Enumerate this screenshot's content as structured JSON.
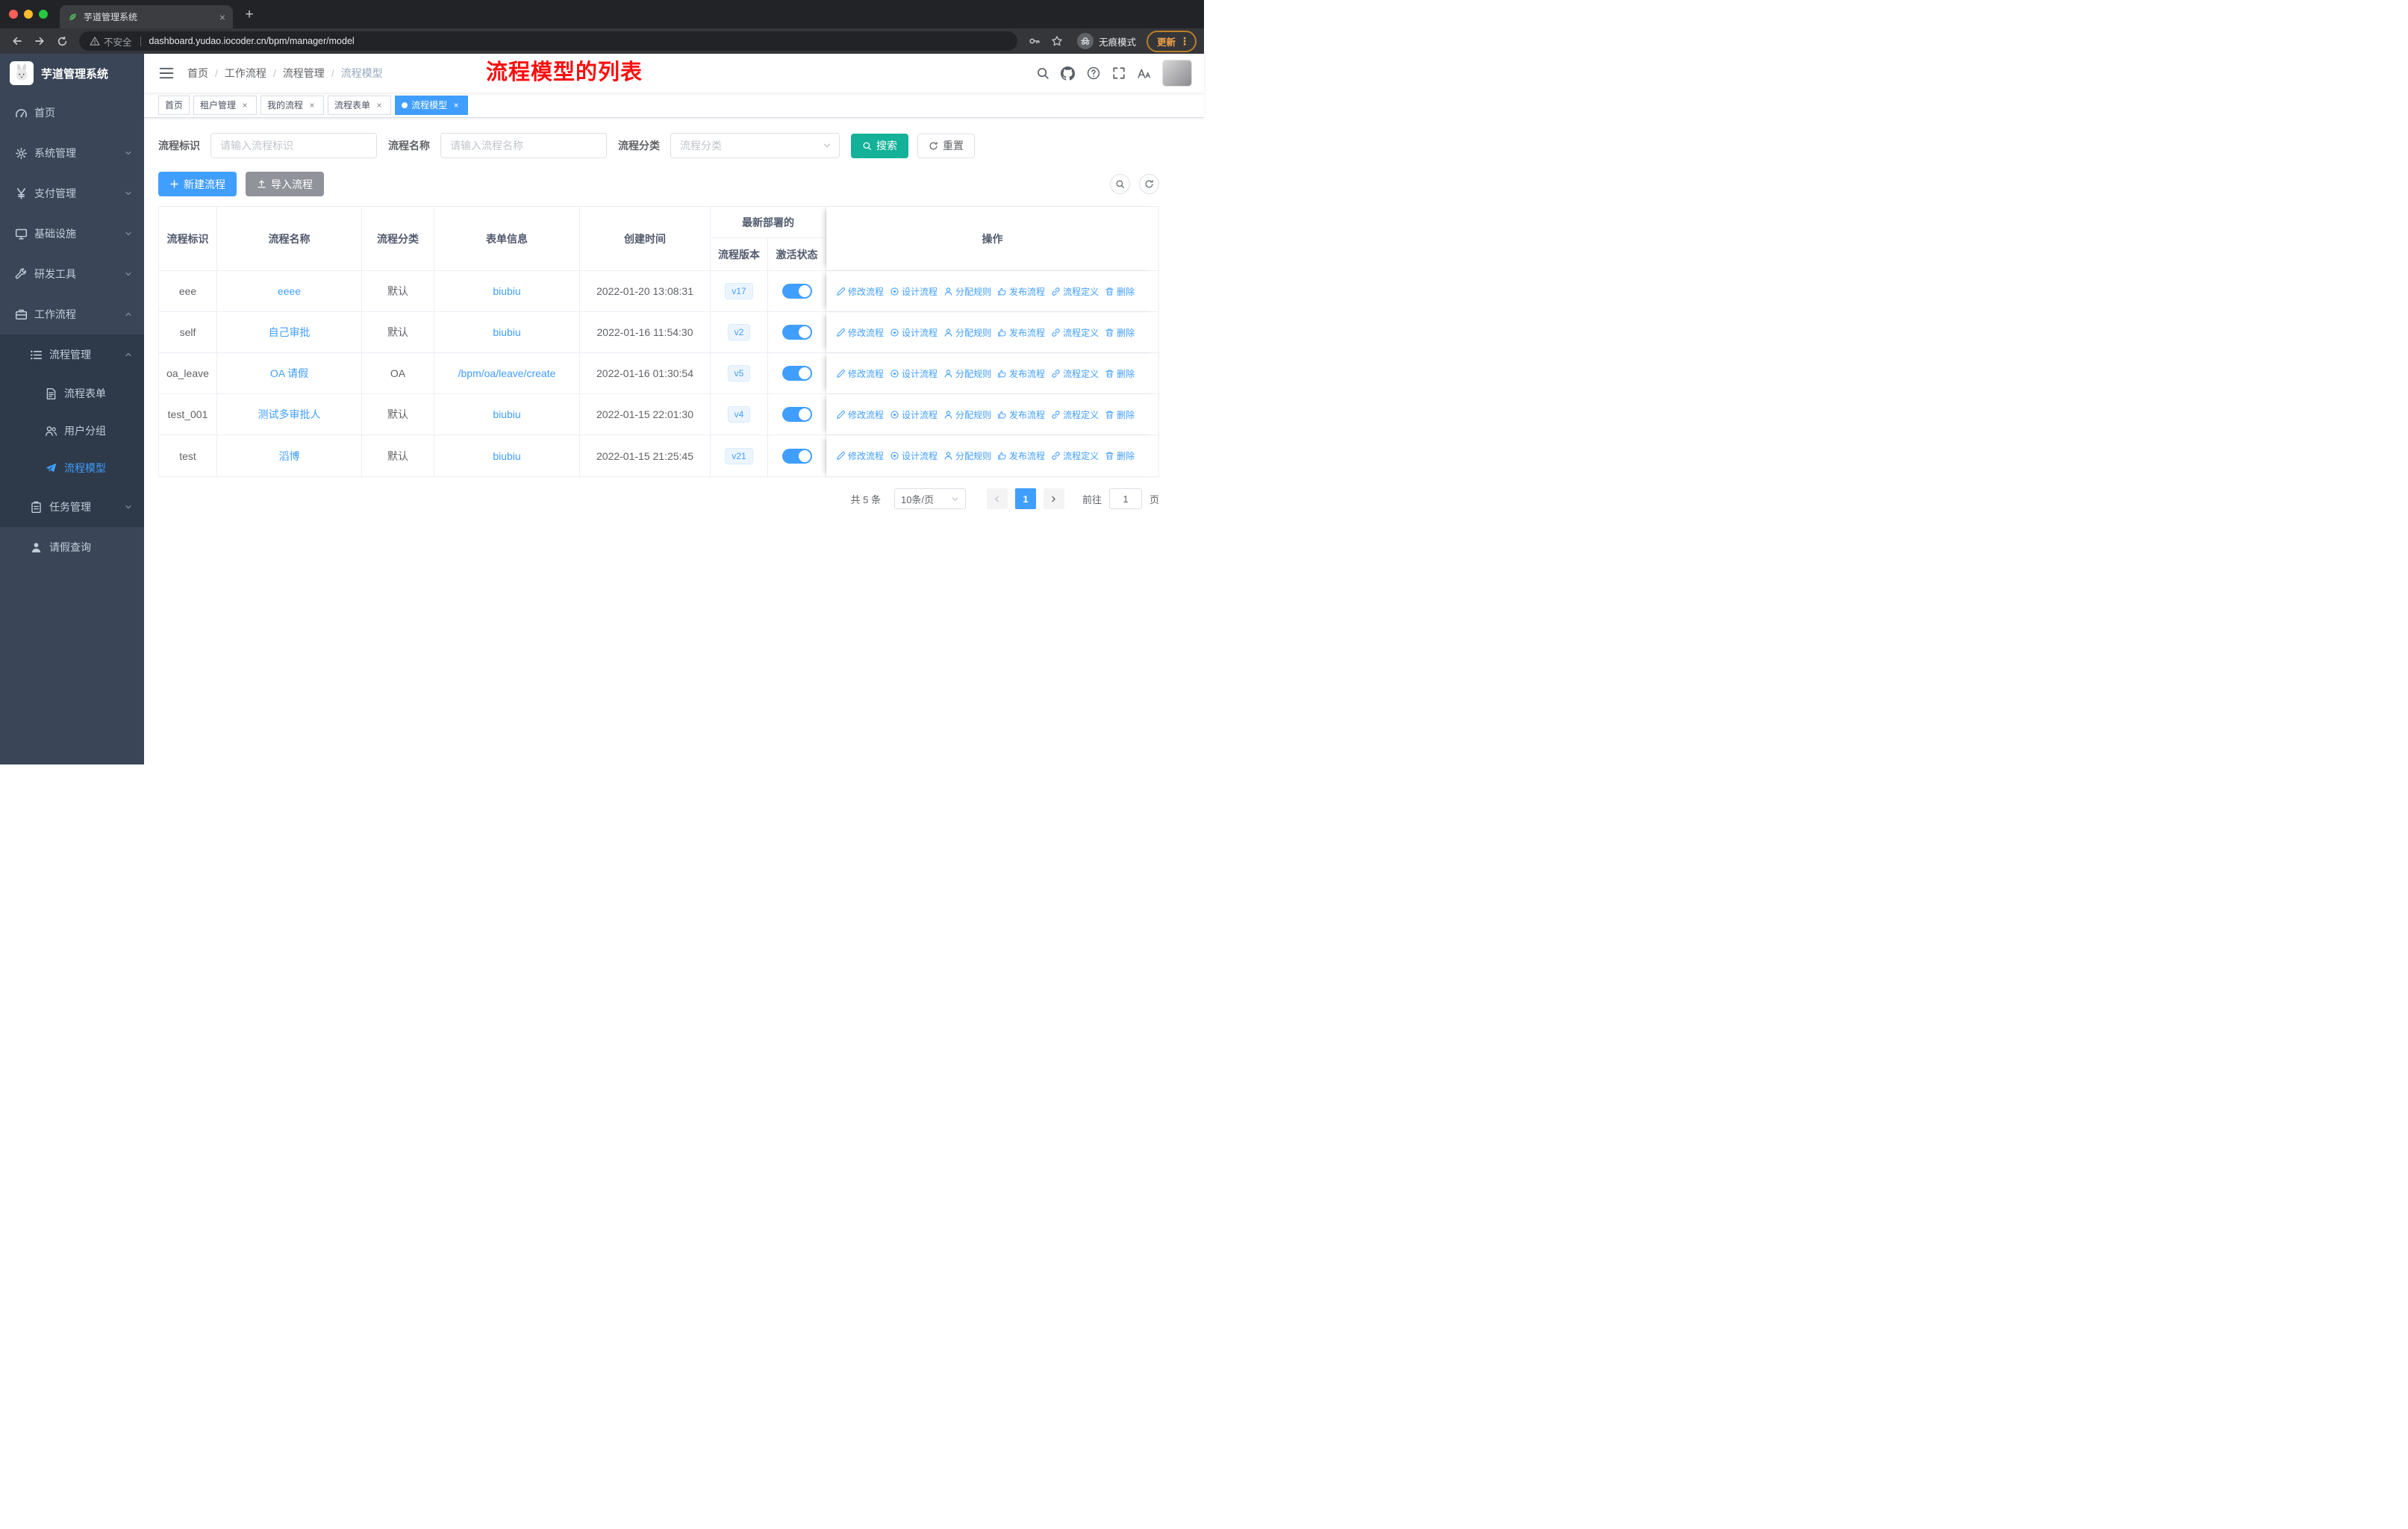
{
  "browser": {
    "tab_title": "芋道管理系统",
    "security_label": "不安全",
    "url": "dashboard.yudao.iocoder.cn/bpm/manager/model",
    "incognito_label": "无痕模式",
    "update_label": "更新"
  },
  "sidebar": {
    "logo_title": "芋道管理系统",
    "items": {
      "home": "首页",
      "system": "系统管理",
      "payment": "支付管理",
      "infra": "基础设施",
      "devtools": "研发工具",
      "workflow": "工作流程",
      "process_mgmt": "流程管理",
      "process_form": "流程表单",
      "user_group": "用户分组",
      "process_model": "流程模型",
      "task_mgmt": "任务管理",
      "leave_query": "请假查询"
    }
  },
  "header": {
    "breadcrumb": [
      "首页",
      "工作流程",
      "流程管理",
      "流程模型"
    ],
    "separator": "/",
    "annotation": "流程模型的列表"
  },
  "tags": [
    {
      "label": "首页",
      "closable": false,
      "active": false
    },
    {
      "label": "租户管理",
      "closable": true,
      "active": false
    },
    {
      "label": "我的流程",
      "closable": true,
      "active": false
    },
    {
      "label": "流程表单",
      "closable": true,
      "active": false
    },
    {
      "label": "流程模型",
      "closable": true,
      "active": true
    }
  ],
  "filters": {
    "id_label": "流程标识",
    "id_placeholder": "请输入流程标识",
    "name_label": "流程名称",
    "name_placeholder": "请输入流程名称",
    "category_label": "流程分类",
    "category_placeholder": "流程分类",
    "search_label": "搜索",
    "reset_label": "重置"
  },
  "toolbar": {
    "create_label": "新建流程",
    "import_label": "导入流程"
  },
  "table": {
    "headers": {
      "id": "流程标识",
      "name": "流程名称",
      "category": "流程分类",
      "form": "表单信息",
      "created": "创建时间",
      "deploy_group": "最新部署的",
      "version": "流程版本",
      "active": "激活状态",
      "ops": "操作"
    },
    "action_labels": [
      "修改流程",
      "设计流程",
      "分配规则",
      "发布流程",
      "流程定义",
      "删除"
    ],
    "rows": [
      {
        "id": "eee",
        "name": "eeee",
        "category": "默认",
        "form": "biubiu",
        "created": "2022-01-20 13:08:31",
        "version": "v17",
        "active": true
      },
      {
        "id": "self",
        "name": "自己审批",
        "category": "默认",
        "form": "biubiu",
        "created": "2022-01-16 11:54:30",
        "version": "v2",
        "active": true
      },
      {
        "id": "oa_leave",
        "name": "OA 请假",
        "category": "OA",
        "form": "/bpm/oa/leave/create",
        "created": "2022-01-16 01:30:54",
        "version": "v5",
        "active": true
      },
      {
        "id": "test_001",
        "name": "测试多审批人",
        "category": "默认",
        "form": "biubiu",
        "created": "2022-01-15 22:01:30",
        "version": "v4",
        "active": true
      },
      {
        "id": "test",
        "name": "滔博",
        "category": "默认",
        "form": "biubiu",
        "created": "2022-01-15 21:25:45",
        "version": "v21",
        "active": true
      }
    ]
  },
  "pagination": {
    "total": "共 5 条",
    "page_size": "10条/页",
    "current_page": "1",
    "goto_label": "前往",
    "goto_value": "1",
    "page_unit": "页"
  },
  "colors": {
    "primary": "#409eff",
    "search_button": "#12b198",
    "annotation": "#fb0e0e",
    "sidebar_bg": "#3a4657",
    "tag_active": "#409eff"
  }
}
